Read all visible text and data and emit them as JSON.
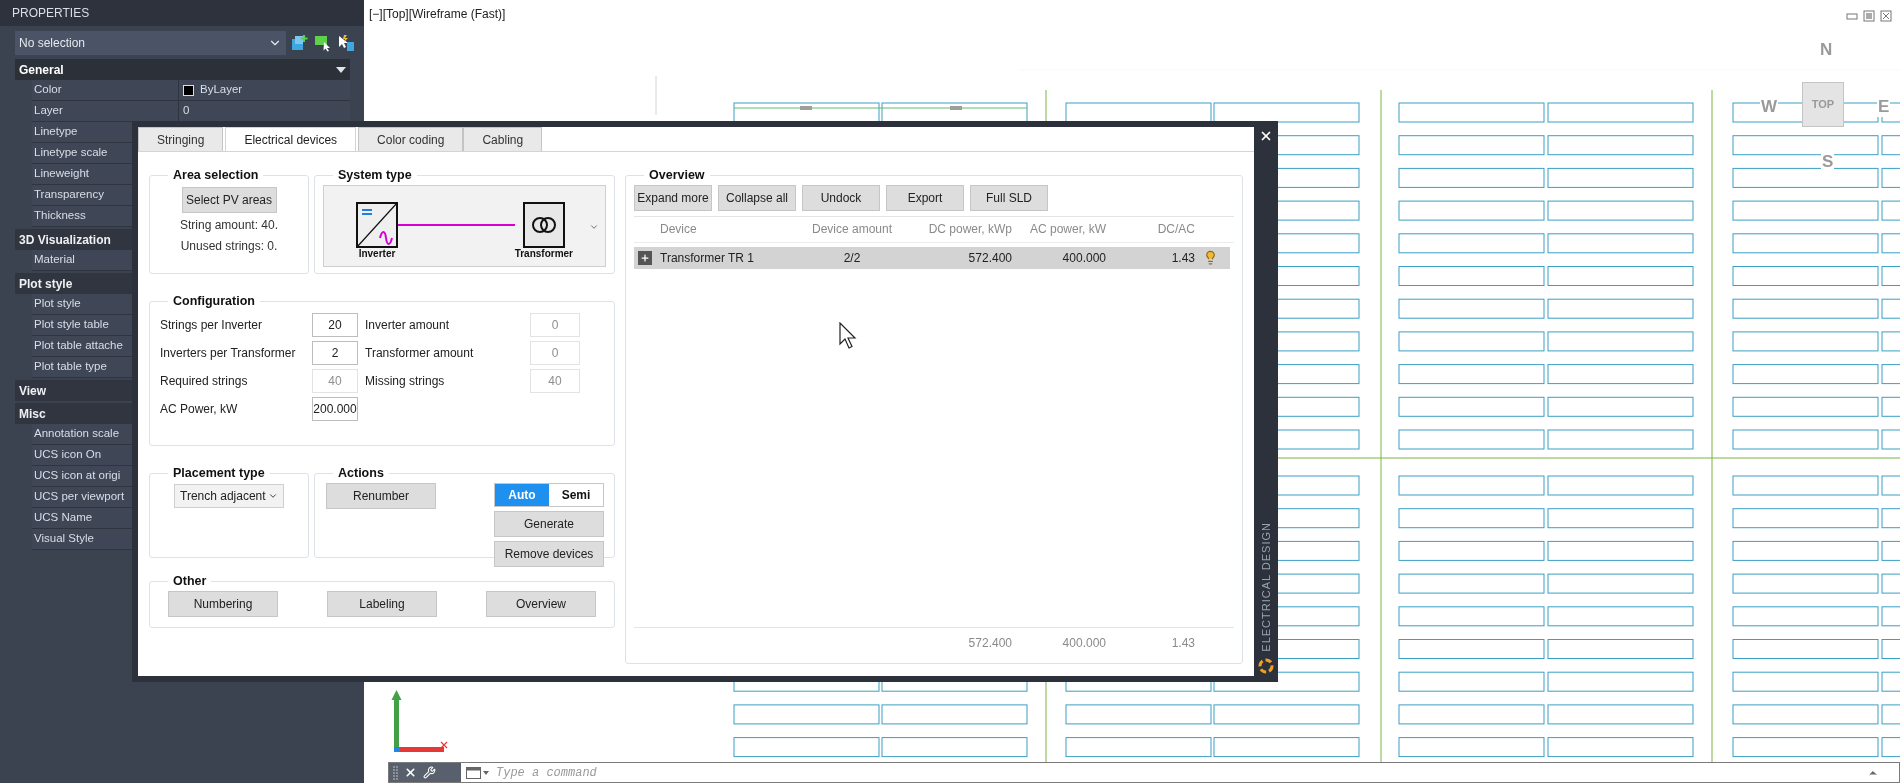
{
  "properties_panel": {
    "title": "PROPERTIES",
    "selection": "No selection",
    "sections": [
      {
        "title": "General",
        "highlighted": true,
        "rows": [
          {
            "label": "Color",
            "value": "ByLayer",
            "kind": "color"
          },
          {
            "label": "Layer",
            "value": "0",
            "kind": "text"
          },
          {
            "label": "Linetype"
          },
          {
            "label": "Linetype scale"
          },
          {
            "label": "Lineweight"
          },
          {
            "label": "Transparency"
          },
          {
            "label": "Thickness"
          }
        ]
      },
      {
        "title": "3D Visualization",
        "highlighted": false,
        "rows": [
          {
            "label": "Material"
          }
        ]
      },
      {
        "title": "Plot style",
        "highlighted": false,
        "rows": [
          {
            "label": "Plot style"
          },
          {
            "label": "Plot style table"
          },
          {
            "label": "Plot table attache"
          },
          {
            "label": "Plot table type"
          }
        ]
      },
      {
        "title": "View",
        "highlighted": false
      },
      {
        "title": "Misc",
        "highlighted": false,
        "rows": [
          {
            "label": "Annotation scale"
          },
          {
            "label": "UCS icon On"
          },
          {
            "label": "UCS icon at origi"
          },
          {
            "label": "UCS per viewport"
          },
          {
            "label": "UCS Name"
          },
          {
            "label": "Visual Style"
          }
        ]
      }
    ]
  },
  "viewport": {
    "label": "[−][Top][Wireframe (Fast)]",
    "compass": {
      "n": "N",
      "w": "W",
      "e": "E",
      "s": "S",
      "top": "TOP"
    }
  },
  "dialog": {
    "side_title": "ELECTRICAL DESIGN",
    "tabs": [
      {
        "label": "Stringing",
        "selected": false
      },
      {
        "label": "Electrical devices",
        "selected": true
      },
      {
        "label": "Color coding",
        "selected": false
      },
      {
        "label": "Cabling",
        "selected": false
      }
    ],
    "area_selection": {
      "title": "Area selection",
      "button": "Select PV areas",
      "lines": [
        "String amount: 40.",
        "Unused strings: 0."
      ]
    },
    "system_type": {
      "title": "System type",
      "devices": [
        {
          "label": "Inverter",
          "kind": "inverter"
        },
        {
          "label": "Transformer",
          "kind": "transformer"
        }
      ]
    },
    "configuration": {
      "title": "Configuration",
      "left_fields": [
        {
          "label": "Strings per Inverter",
          "value": "20",
          "disabled": false
        },
        {
          "label": "Inverters per Transformer",
          "value": "2",
          "disabled": false
        },
        {
          "label": "Required strings",
          "value": "40",
          "disabled": true
        },
        {
          "label": "AC Power, kW",
          "value": "200.000",
          "disabled": false
        }
      ],
      "right_fields": [
        {
          "label": "Inverter amount",
          "value": "0",
          "disabled": true
        },
        {
          "label": "Transformer amount",
          "value": "0",
          "disabled": true
        },
        {
          "label": "Missing strings",
          "value": "40",
          "disabled": true
        }
      ]
    },
    "placement": {
      "title": "Placement type",
      "value": "Trench adjacent"
    },
    "actions": {
      "title": "Actions",
      "button": "Renumber",
      "modes": [
        {
          "label": "Auto",
          "selected": true
        },
        {
          "label": "Semi",
          "selected": false
        }
      ],
      "buttons": [
        "Generate",
        "Remove devices"
      ]
    },
    "other": {
      "title": "Other",
      "buttons": [
        "Numbering",
        "Labeling",
        "Overview"
      ]
    },
    "overview": {
      "title": "Overview",
      "buttons": [
        "Expand more",
        "Collapse all",
        "Undock",
        "Export",
        "Full SLD"
      ],
      "columns": [
        "Device",
        "Device amount",
        "DC power, kWp",
        "AC power, kW",
        "DC/AC"
      ],
      "rows": [
        {
          "device": "Transformer TR 1",
          "amount": "2/2",
          "dc": "572.400",
          "ac": "400.000",
          "ratio": "1.43",
          "expanded": false,
          "selected": true
        }
      ],
      "totals": [
        "572.400",
        "400.000",
        "1.43"
      ]
    }
  },
  "command_line": {
    "placeholder": "Type a command"
  }
}
